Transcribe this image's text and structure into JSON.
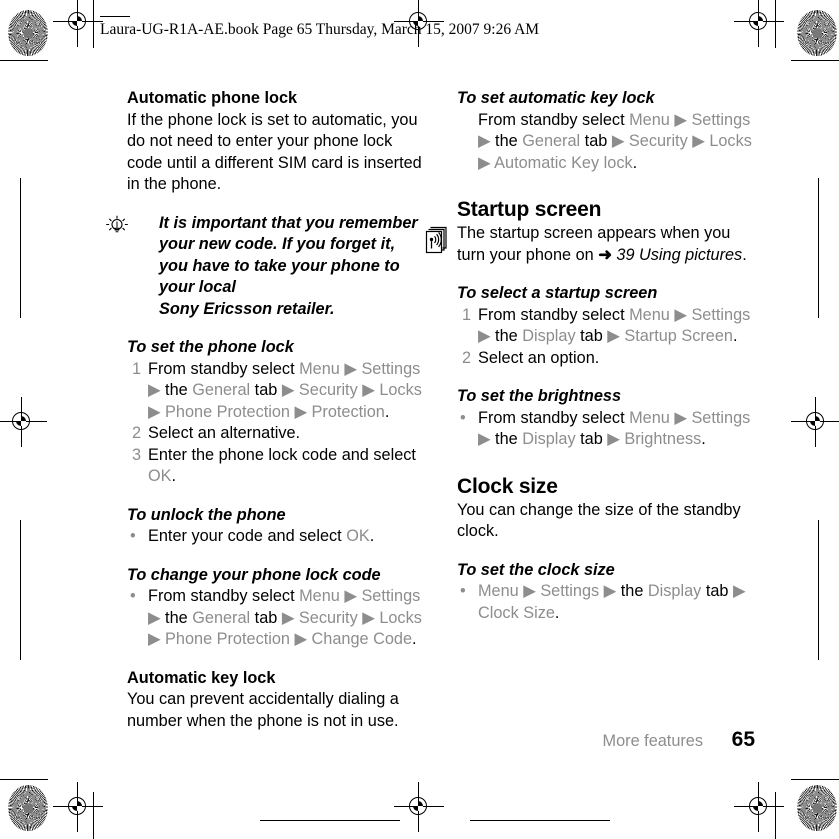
{
  "document": {
    "file_header": "Laura-UG-R1A-AE.book  Page 65  Thursday, March 15, 2007  9:26 AM",
    "footer": {
      "chapter": "More features",
      "page_number": "65"
    }
  },
  "left_column": {
    "section_1": {
      "heading": "Automatic phone lock",
      "body": "If the phone lock is set to automatic, you do not need to enter your phone lock code until a different SIM card is inserted in the phone."
    },
    "tip": {
      "icon": "lightbulb-icon",
      "text": "It is important that you remember your new code. If you forget it, you have to take your phone to your local",
      "text_line4": "Sony Ericsson retailer."
    },
    "task_1": {
      "heading": "To set the phone lock",
      "steps": [
        {
          "num": "1",
          "parts": [
            {
              "t": "From standby select ",
              "s": "plain"
            },
            {
              "t": "Menu",
              "s": "ui"
            },
            {
              "t": " ▶ ",
              "s": "arrow"
            },
            {
              "t": "Settings",
              "s": "ui"
            },
            {
              "t": "\n",
              "s": "break"
            },
            {
              "t": "▶ ",
              "s": "arrow"
            },
            {
              "t": "the ",
              "s": "plain"
            },
            {
              "t": "General",
              "s": "ui"
            },
            {
              "t": " tab",
              "s": "plain"
            },
            {
              "t": " ▶ ",
              "s": "arrow"
            },
            {
              "t": "Security",
              "s": "ui"
            },
            {
              "t": " ▶ ",
              "s": "arrow"
            },
            {
              "t": "Locks",
              "s": "ui"
            },
            {
              "t": "\n",
              "s": "break"
            },
            {
              "t": "▶ ",
              "s": "arrow"
            },
            {
              "t": "Phone Protection",
              "s": "ui"
            },
            {
              "t": " ▶ ",
              "s": "arrow"
            },
            {
              "t": "Protection",
              "s": "ui"
            },
            {
              "t": ".",
              "s": "plain"
            }
          ]
        },
        {
          "num": "2",
          "parts": [
            {
              "t": "Select an alternative.",
              "s": "plain"
            }
          ]
        },
        {
          "num": "3",
          "parts": [
            {
              "t": "Enter the phone lock code and select",
              "s": "plain"
            },
            {
              "t": "\n",
              "s": "break"
            },
            {
              "t": "OK",
              "s": "ui"
            },
            {
              "t": ".",
              "s": "plain"
            }
          ]
        }
      ]
    },
    "task_2": {
      "heading": "To unlock the phone",
      "steps": [
        {
          "num": "•",
          "parts": [
            {
              "t": "Enter your code and select ",
              "s": "plain"
            },
            {
              "t": "OK",
              "s": "ui"
            },
            {
              "t": ".",
              "s": "plain"
            }
          ]
        }
      ]
    },
    "task_3": {
      "heading": "To change your phone lock code",
      "steps": [
        {
          "num": "•",
          "parts": [
            {
              "t": "From standby select ",
              "s": "plain"
            },
            {
              "t": "Menu",
              "s": "ui"
            },
            {
              "t": " ▶ ",
              "s": "arrow"
            },
            {
              "t": "Settings",
              "s": "ui"
            },
            {
              "t": "\n",
              "s": "break"
            },
            {
              "t": "▶ ",
              "s": "arrow"
            },
            {
              "t": "the ",
              "s": "plain"
            },
            {
              "t": "General",
              "s": "ui"
            },
            {
              "t": " tab",
              "s": "plain"
            },
            {
              "t": " ▶ ",
              "s": "arrow"
            },
            {
              "t": "Security",
              "s": "ui"
            },
            {
              "t": " ▶ ",
              "s": "arrow"
            },
            {
              "t": "Locks",
              "s": "ui"
            },
            {
              "t": "\n",
              "s": "break"
            },
            {
              "t": "▶ ",
              "s": "arrow"
            },
            {
              "t": "Phone Protection",
              "s": "ui"
            },
            {
              "t": " ▶ ",
              "s": "arrow"
            },
            {
              "t": "Change Code",
              "s": "ui"
            },
            {
              "t": ".",
              "s": "plain"
            }
          ]
        }
      ]
    },
    "section_2": {
      "heading": "Automatic key lock",
      "body": "You can prevent accidentally dialing a number when the phone is not in use."
    }
  },
  "right_column": {
    "task_1": {
      "heading": "To set automatic key lock",
      "steps": [
        {
          "num": "",
          "parts": [
            {
              "t": "From standby select ",
              "s": "plain"
            },
            {
              "t": "Menu",
              "s": "ui"
            },
            {
              "t": " ▶ ",
              "s": "arrow"
            },
            {
              "t": "Settings",
              "s": "ui"
            },
            {
              "t": "\n",
              "s": "break"
            },
            {
              "t": "▶ ",
              "s": "arrow"
            },
            {
              "t": "the ",
              "s": "plain"
            },
            {
              "t": "General",
              "s": "ui"
            },
            {
              "t": " tab",
              "s": "plain"
            },
            {
              "t": " ▶ ",
              "s": "arrow"
            },
            {
              "t": "Security",
              "s": "ui"
            },
            {
              "t": " ▶ ",
              "s": "arrow"
            },
            {
              "t": "Locks",
              "s": "ui"
            },
            {
              "t": "\n",
              "s": "break"
            },
            {
              "t": "▶ ",
              "s": "arrow"
            },
            {
              "t": "Automatic Key lock",
              "s": "ui"
            },
            {
              "t": ".",
              "s": "plain"
            }
          ]
        }
      ]
    },
    "section_startup": {
      "heading": "Startup screen",
      "icon": "note-signal-icon",
      "body_parts": [
        {
          "t": "The startup screen appears when you turn your phone on ",
          "s": "plain"
        },
        {
          "t": "➜ ",
          "s": "bold-arrow"
        },
        {
          "t": "39 Using pictures",
          "s": "italic"
        },
        {
          "t": ".",
          "s": "plain"
        }
      ]
    },
    "task_2": {
      "heading": "To select a startup screen",
      "steps": [
        {
          "num": "1",
          "parts": [
            {
              "t": "From standby select ",
              "s": "plain"
            },
            {
              "t": "Menu",
              "s": "ui"
            },
            {
              "t": " ▶ ",
              "s": "arrow"
            },
            {
              "t": "Settings",
              "s": "ui"
            },
            {
              "t": "\n",
              "s": "break"
            },
            {
              "t": "▶ ",
              "s": "arrow"
            },
            {
              "t": "the ",
              "s": "plain"
            },
            {
              "t": "Display",
              "s": "ui"
            },
            {
              "t": " tab",
              "s": "plain"
            },
            {
              "t": " ▶ ",
              "s": "arrow"
            },
            {
              "t": "Startup Screen",
              "s": "ui"
            },
            {
              "t": ".",
              "s": "plain"
            }
          ]
        },
        {
          "num": "2",
          "parts": [
            {
              "t": "Select an option.",
              "s": "plain"
            }
          ]
        }
      ]
    },
    "task_3": {
      "heading": "To set the brightness",
      "steps": [
        {
          "num": "•",
          "parts": [
            {
              "t": "From standby select ",
              "s": "plain"
            },
            {
              "t": "Menu",
              "s": "ui"
            },
            {
              "t": " ▶ ",
              "s": "arrow"
            },
            {
              "t": "Settings",
              "s": "ui"
            },
            {
              "t": "\n",
              "s": "break"
            },
            {
              "t": "▶ ",
              "s": "arrow"
            },
            {
              "t": "the ",
              "s": "plain"
            },
            {
              "t": "Display",
              "s": "ui"
            },
            {
              "t": " tab",
              "s": "plain"
            },
            {
              "t": " ▶ ",
              "s": "arrow"
            },
            {
              "t": "Brightness",
              "s": "ui"
            },
            {
              "t": ".",
              "s": "plain"
            }
          ]
        }
      ]
    },
    "section_clock": {
      "heading": "Clock size",
      "body": "You can change the size of the standby clock."
    },
    "task_4": {
      "heading": "To set the clock size",
      "steps": [
        {
          "num": "•",
          "parts": [
            {
              "t": "Menu",
              "s": "ui"
            },
            {
              "t": " ▶ ",
              "s": "arrow"
            },
            {
              "t": "Settings",
              "s": "ui"
            },
            {
              "t": " ▶ ",
              "s": "arrow"
            },
            {
              "t": "the ",
              "s": "plain"
            },
            {
              "t": "Display",
              "s": "ui"
            },
            {
              "t": " tab",
              "s": "plain"
            },
            {
              "t": " ▶ ",
              "s": "arrow"
            },
            {
              "t": "\n",
              "s": "break"
            },
            {
              "t": "Clock Size",
              "s": "ui"
            },
            {
              "t": ".",
              "s": "plain"
            }
          ]
        }
      ]
    }
  },
  "colors": {
    "ui_gray": "#8d8d8d",
    "text_black": "#000000",
    "page_background": "#ffffff"
  }
}
